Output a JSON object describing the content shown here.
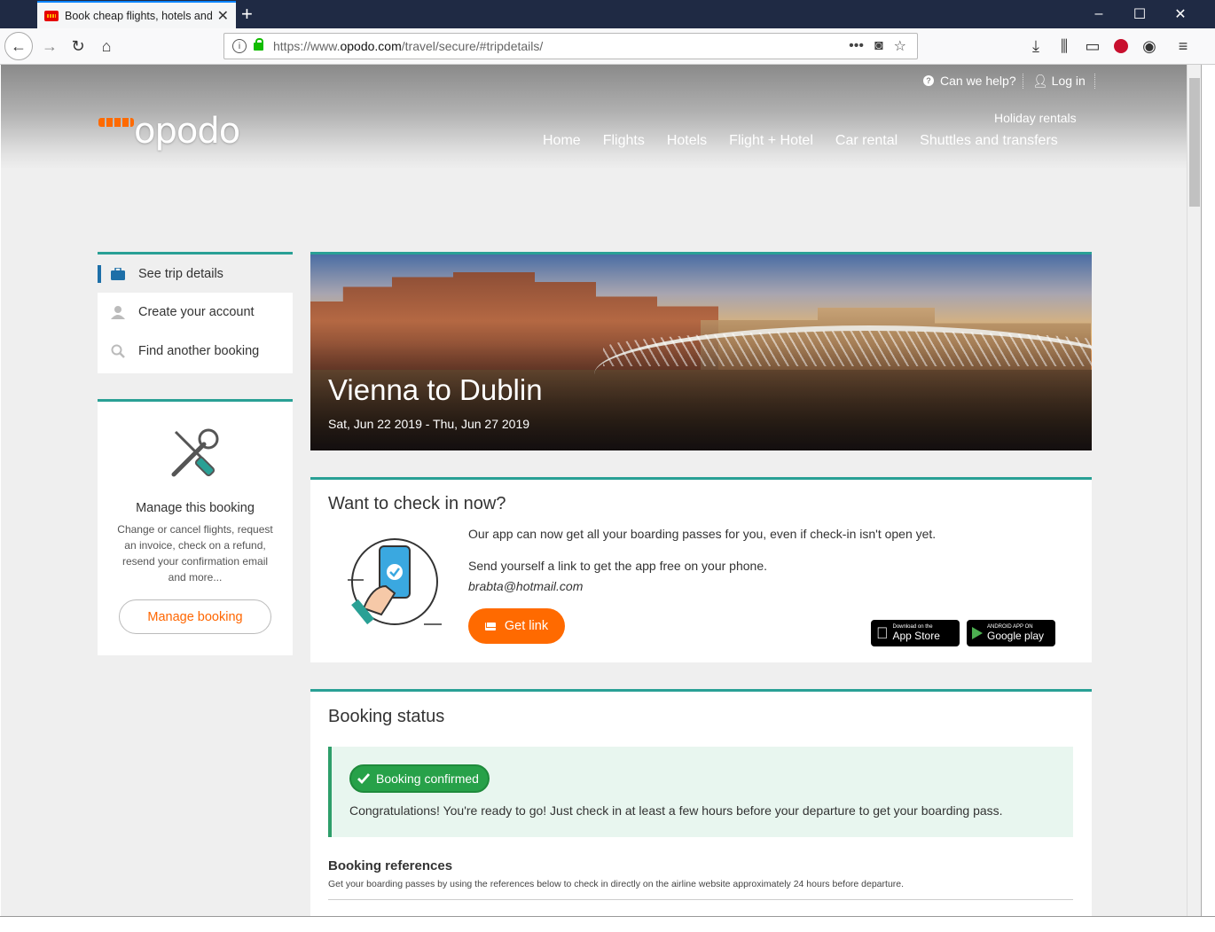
{
  "browser": {
    "tab_title": "Book cheap flights, hotels and",
    "url_prefix": "https://www.",
    "url_domain": "opodo.com",
    "url_path": "/travel/secure/#tripdetails/",
    "colors": {
      "titlebar": "#1f2a44",
      "tab_accent": "#0a84ff"
    }
  },
  "header": {
    "help_label": "Can we help?",
    "login_label": "Log in",
    "logo_text": "opodo",
    "holiday_label": "Holiday rentals",
    "nav": [
      "Home",
      "Flights",
      "Hotels",
      "Flight + Hotel",
      "Car rental",
      "Shuttles and transfers"
    ]
  },
  "sidebar": {
    "items": [
      {
        "label": "See trip details",
        "icon": "briefcase-icon"
      },
      {
        "label": "Create your account",
        "icon": "user-icon"
      },
      {
        "label": "Find another booking",
        "icon": "search-icon"
      }
    ],
    "manage": {
      "title": "Manage this booking",
      "description": "Change or cancel flights, request an invoice, check on a refund, resend your confirmation email and more...",
      "button": "Manage booking"
    }
  },
  "trip": {
    "title": "Vienna to Dublin",
    "dates": "Sat, Jun 22 2019 - Thu, Jun 27 2019"
  },
  "checkin": {
    "title": "Want to check in now?",
    "line1": "Our app can now get all your boarding passes for you, even if check-in isn't open yet.",
    "line2": "Send yourself a link to get the app free on your phone.",
    "email": "brabta@hotmail.com",
    "button": "Get link",
    "appstore_small": "Download on the",
    "appstore_big": "App Store",
    "googleplay_small": "ANDROID APP ON",
    "googleplay_big": "Google play"
  },
  "booking_status": {
    "title": "Booking status",
    "badge": "Booking confirmed",
    "message": "Congratulations! You're ready to go! Just check in at least a few hours before your departure to get your boarding pass.",
    "refs_title": "Booking references",
    "refs_text": "Get your boarding passes by using the references below to check in directly on the airline website approximately 24 hours before departure."
  },
  "theme": {
    "accent_teal": "#29a095",
    "accent_orange": "#ff6a00",
    "confirm_green": "#27a149"
  }
}
